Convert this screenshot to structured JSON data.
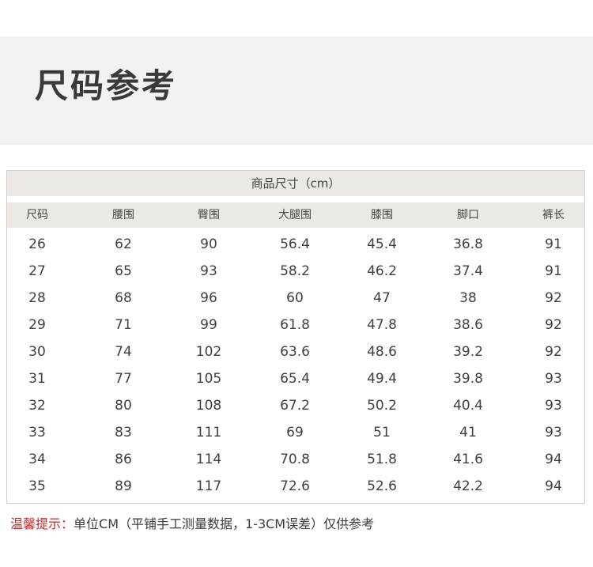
{
  "page": {
    "title": "尺码参考"
  },
  "size_table": {
    "caption": "商品尺寸（cm）",
    "headers": [
      "尺码",
      "腰围",
      "臀围",
      "大腿围",
      "膝围",
      "脚口",
      "裤长"
    ],
    "rows": [
      [
        "26",
        "62",
        "90",
        "56.4",
        "45.4",
        "36.8",
        "91"
      ],
      [
        "27",
        "65",
        "93",
        "58.2",
        "46.2",
        "37.4",
        "91"
      ],
      [
        "28",
        "68",
        "96",
        "60",
        "47",
        "38",
        "92"
      ],
      [
        "29",
        "71",
        "99",
        "61.8",
        "47.8",
        "38.6",
        "92"
      ],
      [
        "30",
        "74",
        "102",
        "63.6",
        "48.6",
        "39.2",
        "92"
      ],
      [
        "31",
        "77",
        "105",
        "65.4",
        "49.4",
        "39.8",
        "93"
      ],
      [
        "32",
        "80",
        "108",
        "67.2",
        "50.2",
        "40.4",
        "93"
      ],
      [
        "33",
        "83",
        "111",
        "69",
        "51",
        "41",
        "93"
      ],
      [
        "34",
        "86",
        "114",
        "70.8",
        "51.8",
        "41.6",
        "94"
      ],
      [
        "35",
        "89",
        "117",
        "72.6",
        "52.6",
        "42.2",
        "94"
      ]
    ]
  },
  "note": {
    "label": "温馨提示：",
    "text": "单位CM（平铺手工测量数据，1-3CM误差）仅供参考"
  },
  "colors": {
    "title_band": "#f3f2f1",
    "table_header": "#ece8e4",
    "note_label": "#c42a2a",
    "text": "#3a3a3a"
  }
}
